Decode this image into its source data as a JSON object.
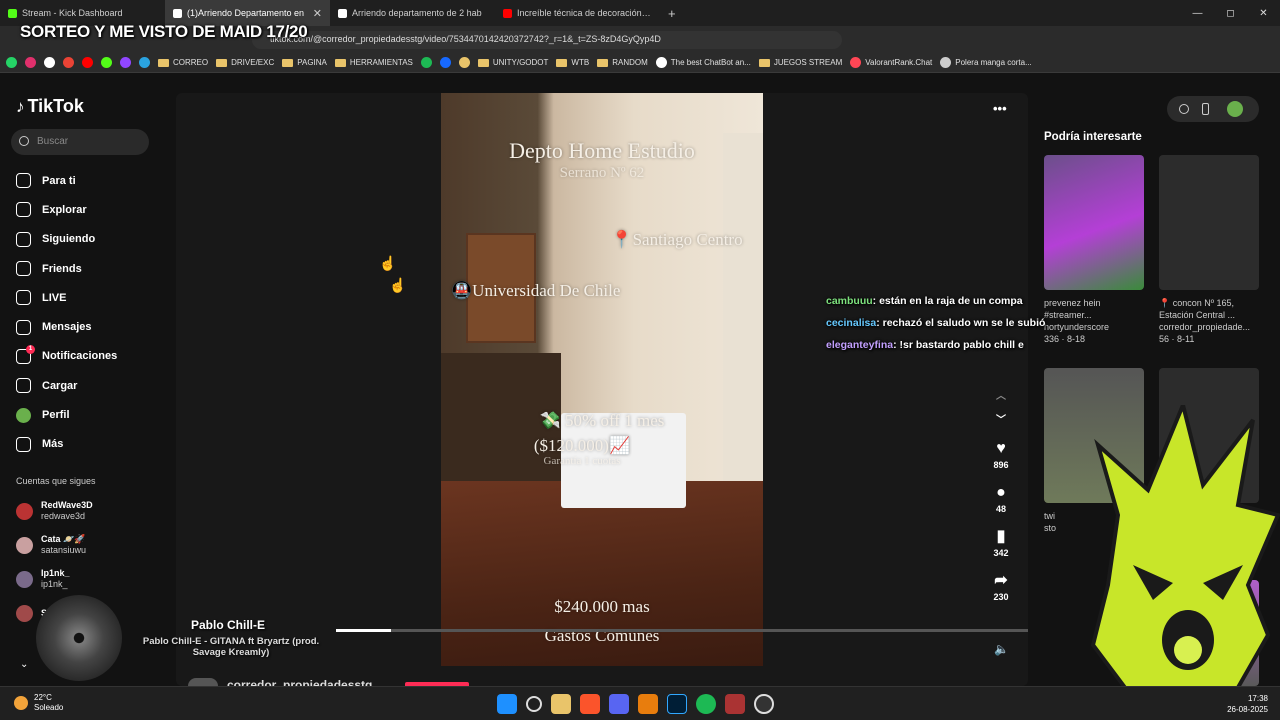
{
  "browser": {
    "tabs": [
      {
        "label": "Stream - Kick Dashboard",
        "color": "#53fc18",
        "active": false
      },
      {
        "label": "(1)Arriendo Departamento en",
        "color": "#ffffff",
        "active": true
      },
      {
        "label": "Arriendo departamento de 2 hab",
        "color": "#ffffff",
        "active": false
      },
      {
        "label": "Increíble técnica de decoración de p",
        "color": "#ff0000",
        "active": false
      }
    ],
    "new_tab": "+",
    "url": "tiktok.com/@corredor_propiedadesstg/video/7534470142420372742?_r=1&_t=ZS-8zD4GyQyp4D",
    "window_controls": [
      "—",
      "◻",
      "✕"
    ]
  },
  "stream_overlay": {
    "title": "SORTEO Y ME VISTO DE MAID 17/20"
  },
  "bookmarks": [
    {
      "label": "",
      "type": "whatsapp",
      "color": "#25d366"
    },
    {
      "label": "",
      "type": "instagram",
      "color": "#e1306c"
    },
    {
      "label": "",
      "type": "x",
      "color": "#ffffff"
    },
    {
      "label": "",
      "type": "gmail",
      "color": "#ea4335"
    },
    {
      "label": "",
      "type": "youtube",
      "color": "#ff0000"
    },
    {
      "label": "",
      "type": "kick",
      "color": "#53fc18"
    },
    {
      "label": "",
      "type": "twitch",
      "color": "#9146ff"
    },
    {
      "label": "",
      "type": "telegram",
      "color": "#2aa3e0"
    },
    {
      "label": "CORREO",
      "type": "folder"
    },
    {
      "label": "DRIVE/EXC",
      "type": "folder"
    },
    {
      "label": "PAGINA",
      "type": "folder"
    },
    {
      "label": "HERRAMIENTAS",
      "type": "folder"
    },
    {
      "label": "",
      "type": "green",
      "color": "#1db954"
    },
    {
      "label": "",
      "type": "behance",
      "color": "#1769ff"
    },
    {
      "label": "",
      "type": "folder-alt",
      "color": "#e9c46a"
    },
    {
      "label": "UNITY/GODOT",
      "type": "folder"
    },
    {
      "label": "WTB",
      "type": "folder"
    },
    {
      "label": "RANDOM",
      "type": "folder"
    },
    {
      "label": "The best ChatBot an...",
      "type": "site",
      "color": "#ffffff"
    },
    {
      "label": "JUEGOS STREAM",
      "type": "folder"
    },
    {
      "label": "ValorantRank.Chat",
      "type": "site",
      "color": "#ff4655"
    },
    {
      "label": "Polera manga corta...",
      "type": "site",
      "color": "#cccccc"
    }
  ],
  "sidebar": {
    "logo": "TikTok",
    "search_placeholder": "Buscar",
    "menu": [
      {
        "label": "Para ti",
        "icon": "home-icon"
      },
      {
        "label": "Explorar",
        "icon": "compass-icon"
      },
      {
        "label": "Siguiendo",
        "icon": "following-icon"
      },
      {
        "label": "Friends",
        "icon": "friends-icon"
      },
      {
        "label": "LIVE",
        "icon": "live-icon"
      },
      {
        "label": "Mensajes",
        "icon": "messages-icon"
      },
      {
        "label": "Notificaciones",
        "icon": "notifications-icon",
        "badge": "1"
      },
      {
        "label": "Cargar",
        "icon": "upload-icon"
      },
      {
        "label": "Perfil",
        "icon": "profile-icon"
      },
      {
        "label": "Más",
        "icon": "more-icon"
      }
    ],
    "following_header": "Cuentas que sigues",
    "following": [
      {
        "name": "RedWave3D",
        "handle": "redwave3d"
      },
      {
        "name": "Cata 🪐🚀",
        "handle": "satansiuwu"
      },
      {
        "name": "Ip1nk_",
        "handle": "ip1nk_"
      },
      {
        "name": "Shar",
        "handle": ""
      }
    ]
  },
  "video": {
    "overlay_texts": [
      "Depto Home Estudio",
      "Serrano Nº 62",
      "📍Santiago Centro",
      "🚇Universidad De Chile",
      "💸 50% off 1 mes",
      "($120.000)📈",
      "Garantía 1 cuotas",
      "$240.000 mas",
      "Gastos Comunes"
    ],
    "progress": 0.08,
    "likes": "896",
    "comments": "48",
    "saves": "342",
    "shares": "230",
    "author": "corredor_propiedadesstg"
  },
  "recommended": {
    "title": "Podría interesarte",
    "items": [
      {
        "caption": "prevenez hein #streamer...",
        "author": "hortyunderscore",
        "stats": "336 · 8-18"
      },
      {
        "caption": "📍 concon Nº 165, Estación Central ...",
        "author": "corredor_propiedade...",
        "stats": "56 · 8-11"
      },
      {
        "caption": "twi",
        "author": "sto",
        "stats": ""
      }
    ]
  },
  "chat": [
    {
      "user": "cambuuu",
      "msg": ": están en la raja de un compa"
    },
    {
      "user": "cecinalisa",
      "msg": ": rechazó el saludo wn se le subió"
    },
    {
      "user": "eleganteyfina",
      "msg": ": !sr bastardo pablo chill e"
    }
  ],
  "now_playing": {
    "title": "Pablo Chill-E",
    "subtitle": "Pablo Chill-E - GITANA ft Bryartz (prod. Savage Kreamly)"
  },
  "taskbar": {
    "temperature": "22°C",
    "condition": "Soleado",
    "weather_badge": "4",
    "time": "17:38",
    "date": "26-08-2025"
  }
}
